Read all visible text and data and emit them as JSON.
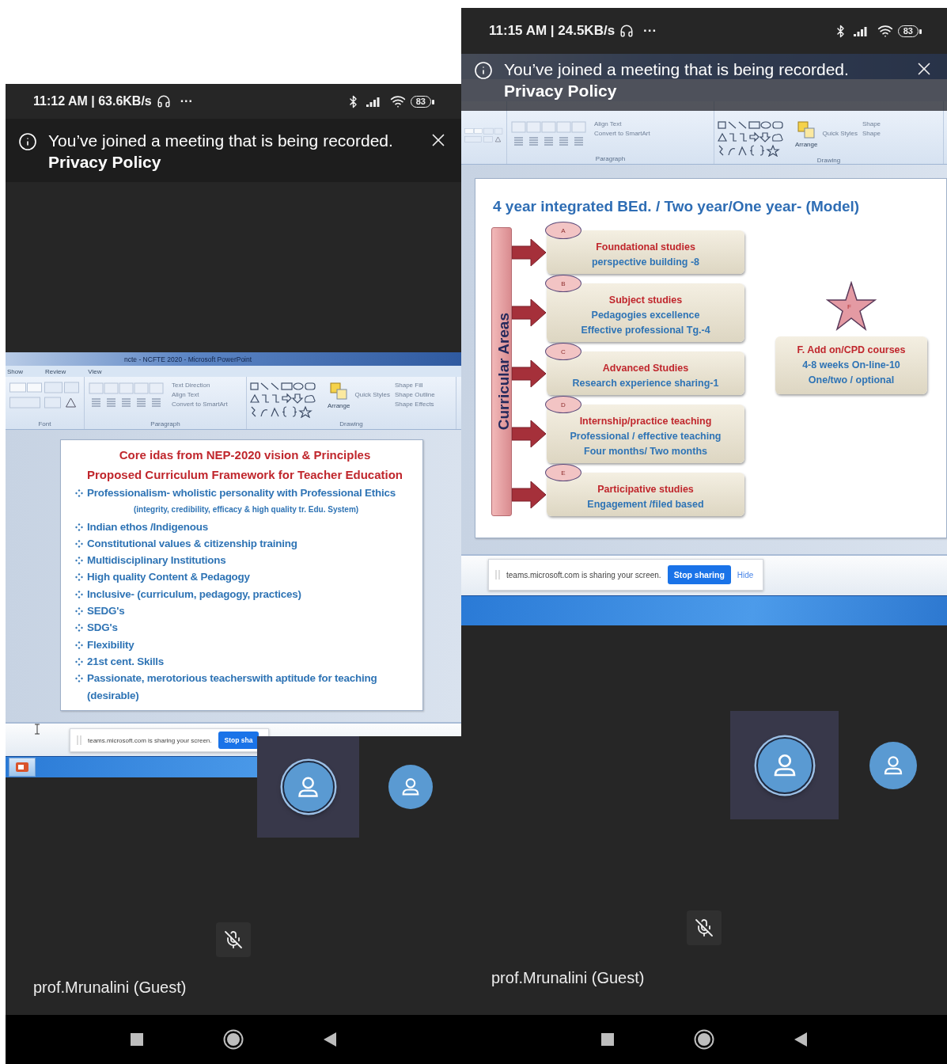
{
  "phones": [
    {
      "status_bar": {
        "time": "11:12 AM | 63.6KB/s",
        "more": "···",
        "battery": "83"
      },
      "banner": {
        "message": "You’ve joined a meeting that is being recorded.",
        "link": "Privacy Policy"
      },
      "shared_screen": {
        "window_title": "ncte - NCFTE 2020 - Microsoft PowerPoint",
        "ribbon_tabs": [
          "Show",
          "Review",
          "View"
        ],
        "ribbon_groups": [
          {
            "kind": "font",
            "label": "Font"
          },
          {
            "kind": "paragraph",
            "label": "Paragraph",
            "commands": [
              "Text Direction",
              "Align Text",
              "Convert to SmartArt"
            ]
          },
          {
            "kind": "drawing",
            "label": "Drawing",
            "commands": [
              "Arrange",
              "Quick Styles"
            ],
            "shape_commands": [
              "Shape Fill",
              "Shape Outline",
              "Shape Effects"
            ]
          }
        ],
        "slide": {
          "kind": "bullets",
          "title_lines": [
            "Core idas from  NEP-2020 vision & Principles",
            "Proposed Curriculum Framework for Teacher Education"
          ],
          "bullets": [
            {
              "text": "Professionalism- wholistic personality with Professional Ethics",
              "note": "(integrity, credibility, efficacy & high quality tr. Edu. System)"
            },
            {
              "text": "Indian ethos /Indigenous"
            },
            {
              "text": "Constitutional values & citizenship training"
            },
            {
              "text": "Multidisciplinary Institutions"
            },
            {
              "text": "High quality Content & Pedagogy"
            },
            {
              "text": "Inclusive- (curriculum, pedagogy, practices)"
            },
            {
              "text": "SEDG's"
            },
            {
              "text": "SDG's"
            },
            {
              "text": "Flexibility"
            },
            {
              "text": "21st cent. Skills"
            },
            {
              "text": "Passionate, merotorious  teacherswith aptitude for teaching (desirable)"
            }
          ]
        },
        "share_bar": {
          "message": "teams.microsoft.com is sharing your screen.",
          "stop_button": "Stop sha"
        }
      },
      "tiles": [
        {
          "speaking": true
        },
        {
          "speaking": false
        }
      ],
      "participant": "prof.Mrunalini (Guest)"
    },
    {
      "status_bar": {
        "time": "11:15 AM | 24.5KB/s",
        "more": "···",
        "battery": "83"
      },
      "banner": {
        "message": "You’ve joined a meeting that is being recorded.",
        "link": "Privacy Policy"
      },
      "shared_screen": {
        "ribbon_groups": [
          {
            "kind": "font"
          },
          {
            "kind": "paragraph",
            "label": "Paragraph",
            "commands": [
              "Align Text",
              "Convert to SmartArt"
            ]
          },
          {
            "kind": "drawing",
            "label": "Drawing",
            "commands": [
              "Arrange",
              "Quick Styles"
            ],
            "shape_commands": [
              "Shape",
              "Shape"
            ]
          }
        ],
        "slide": {
          "kind": "diagram",
          "title": "4 year integrated BEd. / Two year/One year- (Model)",
          "side_label": "Curricular Areas",
          "boxes": [
            {
              "letter": "A",
              "title": "Foundational studies",
              "lines": [
                "perspective building -8"
              ]
            },
            {
              "letter": "B",
              "title": "Subject studies",
              "lines": [
                "Pedagogies  excellence",
                "Effective professional Tg.-4"
              ]
            },
            {
              "letter": "C",
              "title": "Advanced Studies",
              "lines": [
                "Research experience sharing-1"
              ]
            },
            {
              "letter": "D",
              "title": "Internship/practice teaching",
              "lines": [
                "Professional / effective teaching",
                "Four months/ Two months"
              ]
            },
            {
              "letter": "E",
              "title": "Participative  studies",
              "lines": [
                "Engagement /filed based"
              ]
            }
          ],
          "extra": {
            "letter": "F",
            "title": "F. Add on/CPD  courses",
            "lines": [
              "4-8 weeks On-line-10",
              "One/two / optional"
            ]
          }
        },
        "share_bar": {
          "message": "teams.microsoft.com is sharing your screen.",
          "stop_button": "Stop sharing",
          "hide": "Hide"
        }
      },
      "tiles": [
        {
          "speaking": true
        },
        {
          "speaking": false
        }
      ],
      "participant": "prof.Mrunalini (Guest)"
    }
  ]
}
